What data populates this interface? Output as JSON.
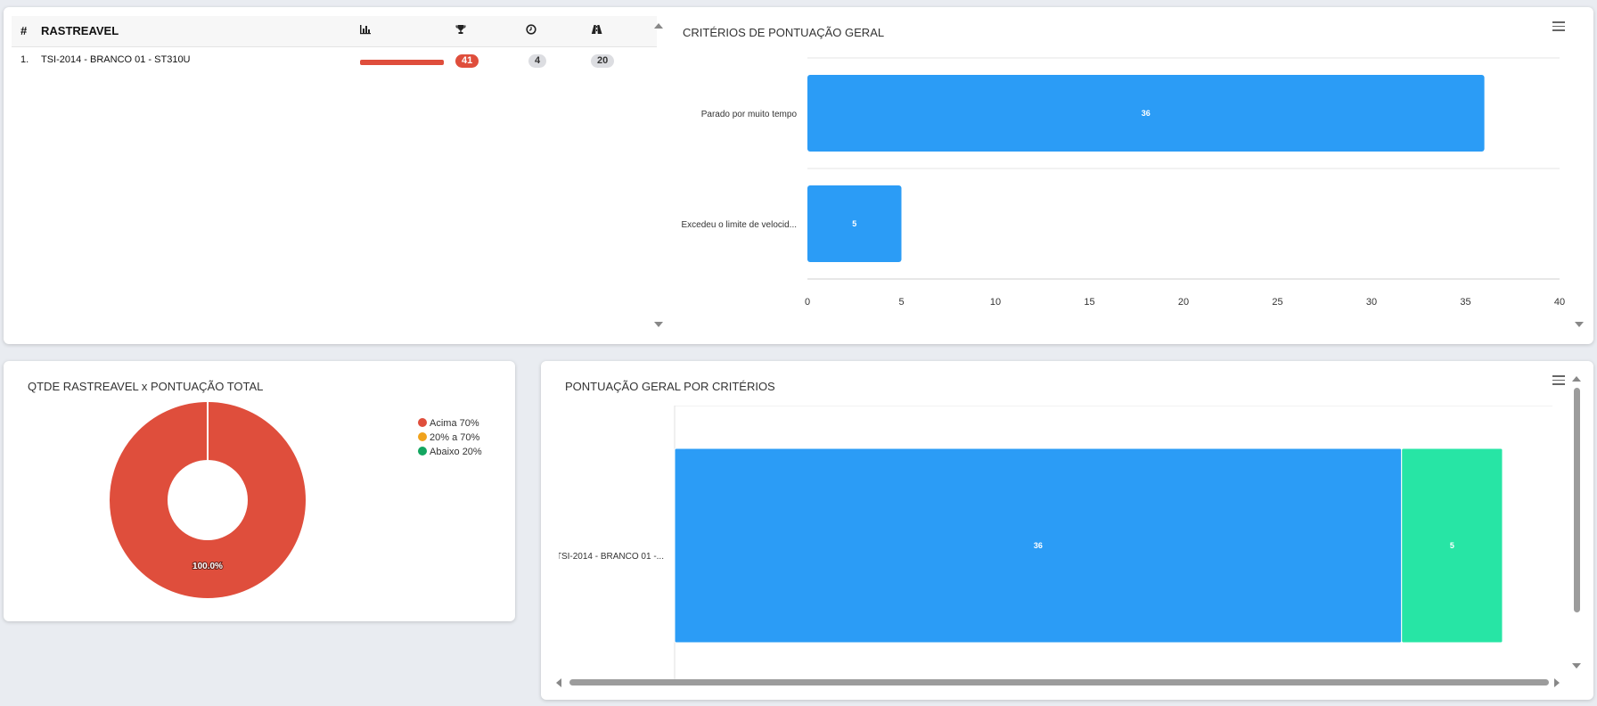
{
  "ranking_table": {
    "headers": {
      "index": "#",
      "name": "RASTREAVEL"
    },
    "header_icons": [
      "bar-chart-icon",
      "trophy-icon",
      "clock-icon",
      "road-icon"
    ],
    "rows": [
      {
        "index": "1.",
        "name": "TSI-2014 - BRANCO 01 - ST310U",
        "progress": 1.0,
        "score": "41",
        "events": "4",
        "distance": "20"
      }
    ]
  },
  "criteria_chart": {
    "title": "CRITÉRIOS DE PONTUAÇÃO GERAL",
    "chart_data": {
      "type": "bar",
      "orientation": "horizontal",
      "categories": [
        "Parado por muito tempo",
        "Excedeu o limite de velocid..."
      ],
      "values": [
        36,
        5
      ],
      "xlim": [
        0,
        40
      ],
      "ticks": [
        "0",
        "5",
        "10",
        "15",
        "20",
        "25",
        "30",
        "35",
        "40"
      ],
      "data_labels": [
        "36",
        "5"
      ],
      "color": "#2b9cf6"
    }
  },
  "donut_chart": {
    "title": "QTDE RASTREAVEL x PONTUAÇÃO TOTAL",
    "chart_data": {
      "type": "pie",
      "slices": [
        {
          "name": "Acima 70%",
          "value": 100.0,
          "color": "#df4e3c"
        },
        {
          "name": "20% a 70%",
          "value": 0,
          "color": "#f0a21c"
        },
        {
          "name": "Abaixo 20%",
          "value": 0,
          "color": "#13a660"
        }
      ],
      "data_label": "100.0%"
    }
  },
  "stacked_chart": {
    "title": "PONTUAÇÃO GERAL POR CRITÉRIOS",
    "chart_data": {
      "type": "bar",
      "orientation": "horizontal",
      "stacked": true,
      "categories": [
        "TSI-2014 - BRANCO 01 -..."
      ],
      "series": [
        {
          "values": [
            36
          ],
          "color": "#2b9cf6",
          "label": "36"
        },
        {
          "values": [
            5
          ],
          "color": "#27e5a5",
          "label": "5"
        }
      ]
    }
  },
  "colors": {
    "accent_blue": "#2b9cf6",
    "accent_red": "#df4e3c",
    "accent_green": "#27e5a5",
    "badge_grey": "#dcdde1"
  }
}
